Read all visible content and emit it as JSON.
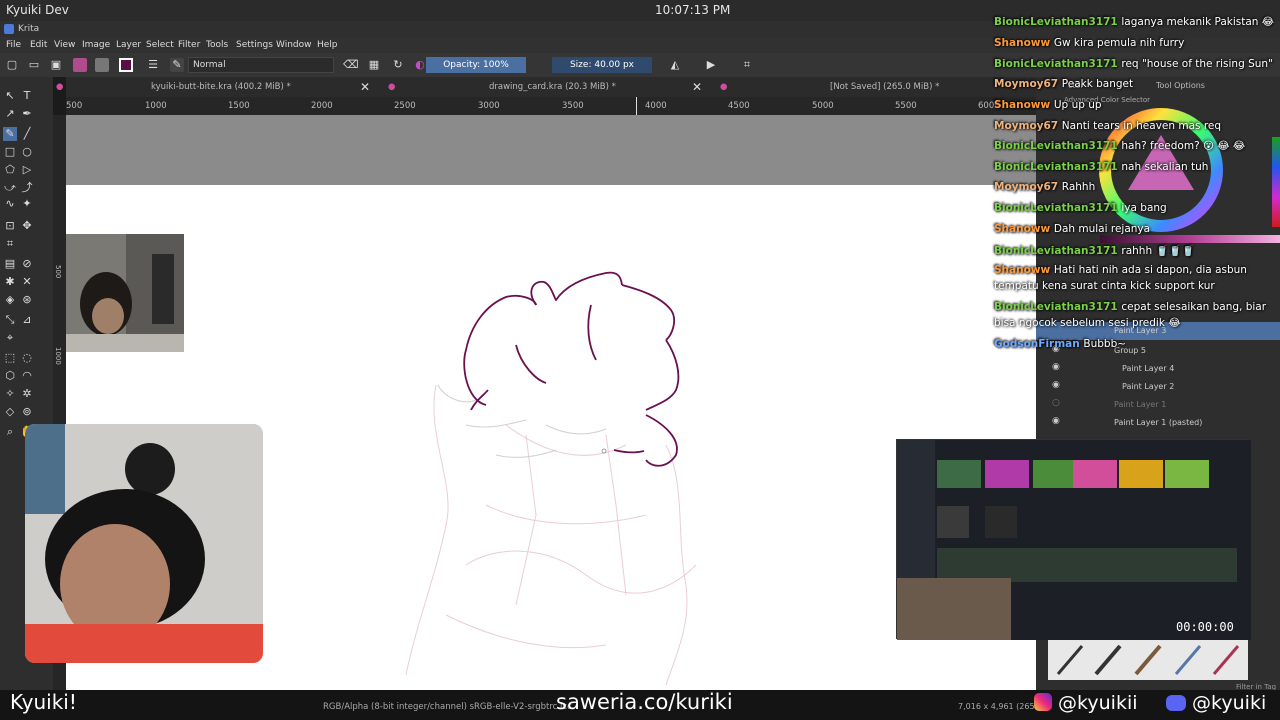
{
  "system": {
    "app_name": "Kyuiki Dev",
    "clock": "10:07:13 PM"
  },
  "window": {
    "title": "Krita"
  },
  "menu": [
    "File",
    "Edit",
    "View",
    "Image",
    "Layer",
    "Select",
    "Filter",
    "Tools",
    "Settings",
    "Window",
    "Help"
  ],
  "toolbar": {
    "blend_mode": "Normal",
    "opacity": "Opacity: 100%",
    "size": "Size: 40.00 px"
  },
  "tabs": [
    {
      "label": "kyuiki-butt-bite.kra (400.2 MiB) *"
    },
    {
      "label": "drawing_card.kra (20.3 MiB) *"
    },
    {
      "label": "[Not Saved]  (265.0 MiB) *"
    }
  ],
  "ruler": [
    "500",
    "1000",
    "1500",
    "2000",
    "2500",
    "3000",
    "3500",
    "4000",
    "4500",
    "5000",
    "5500",
    "6000"
  ],
  "vruler": [
    "500",
    "1000"
  ],
  "docker": {
    "tab_tool_options": "Tool Options",
    "color_selector": "Advanced Color Selector",
    "tab_partial": "ctor"
  },
  "chat": [
    {
      "user": "BionicLeviathan3171",
      "text": "laganya mekanik Pakistan 😂",
      "color": "#7bd148"
    },
    {
      "user": "Shanoww",
      "text": "Gw kira pemula nih furry",
      "color": "#ff9a3c"
    },
    {
      "user": "BionicLeviathan3171",
      "text": "req \"house of the rising Sun\"",
      "color": "#7bd148"
    },
    {
      "user": "Moymoy67",
      "text": "Peakk banget",
      "color": "#f0b37e"
    },
    {
      "user": "Shanoww",
      "text": "Up up up",
      "color": "#ff9a3c"
    },
    {
      "user": "Moymoy67",
      "text": "Nanti tears in heaven mas req",
      "color": "#f0b37e"
    },
    {
      "user": "BionicLeviathan3171",
      "text": "hah? freedom? 😮 😂 😂",
      "color": "#7bd148"
    },
    {
      "user": "BionicLeviathan3171",
      "text": "nah sekalian tuh",
      "color": "#7bd148"
    },
    {
      "user": "Moymoy67",
      "text": "Rahhh",
      "color": "#f0b37e"
    },
    {
      "user": "BionicLeviathan3171",
      "text": "iya bang",
      "color": "#7bd148"
    },
    {
      "user": "Shanoww",
      "text": "Dah mulai rejanya",
      "color": "#ff9a3c"
    },
    {
      "user": "BionicLeviathan3171",
      "text": "rahhh 🥤🥤🥤",
      "color": "#7bd148"
    },
    {
      "user": "Shanoww",
      "text": "Hati hati nih ada si dapon, dia asbun",
      "color": "#ff9a3c"
    },
    {
      "user": "",
      "text": "tempatu kena surat cinta kick support kur",
      "color": "#ff9a3c"
    },
    {
      "user": "BionicLeviathan3171",
      "text": "cepat selesaikan bang, biar",
      "color": "#7bd148"
    },
    {
      "user": "",
      "text": "bisa ngocok sebelum sesi predik 😂",
      "color": "#7bd148"
    },
    {
      "user": "GodsonFirman",
      "text": "Bubbb~",
      "color": "#6fa8ff"
    }
  ],
  "layers": [
    {
      "name": "Paint Layer 3"
    },
    {
      "name": "Group 5"
    },
    {
      "name": "Paint Layer 4"
    },
    {
      "name": "Paint Layer 2"
    },
    {
      "name": "Paint Layer 1"
    },
    {
      "name": "Paint Layer 1 (pasted)"
    }
  ],
  "timer": "00:00:00",
  "status": {
    "color_profile": "RGB/Alpha (8-bit integer/channel)  sRGB-elle-V2-srgbtrc.icc",
    "coords": "7,016 x 4,961 (265"
  },
  "overlay": {
    "brand": "Kyuiki!",
    "saweria": "saweria.co/kuriki",
    "instagram": "@kyuikii",
    "discord": "@kyuiki",
    "filter_hint": "Filter in Tag"
  },
  "colors": {
    "accent": "#4a6fa0",
    "canvas": "#ffffff",
    "stroke": "#6a0f4f"
  }
}
